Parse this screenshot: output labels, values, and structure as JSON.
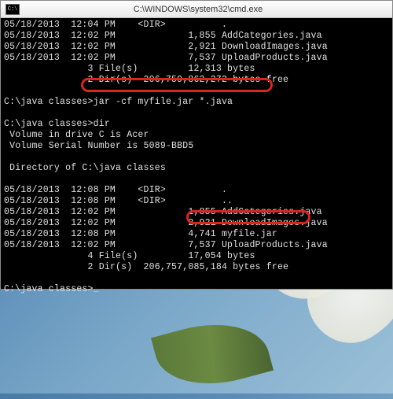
{
  "window": {
    "title": "C:\\WINDOWS\\system32\\cmd.exe",
    "icon_label": "C:\\"
  },
  "terminal": {
    "block1": {
      "l1": "05/18/2013  12:04 PM    <DIR>          .",
      "l2": "05/18/2013  12:02 PM             1,855 AddCategories.java",
      "l3": "05/18/2013  12:02 PM             2,921 DownloadImages.java",
      "l4": "05/18/2013  12:02 PM             7,537 UploadProducts.java",
      "l5": "               3 File(s)         12,313 bytes",
      "l6": "               2 Dir(s)  206,759,862,272 bytes free"
    },
    "cmd1": {
      "prompt": "C:\\java classes>",
      "command": "jar -cf myfile.jar *.java"
    },
    "cmd2": {
      "prompt": "C:\\java classes>",
      "command": "dir"
    },
    "vol": {
      "l1": " Volume in drive C is Acer",
      "l2": " Volume Serial Number is 5089-BBD5"
    },
    "dirof": " Directory of C:\\java classes",
    "block2": {
      "l1": "05/18/2013  12:08 PM    <DIR>          .",
      "l2": "05/18/2013  12:08 PM    <DIR>          ..",
      "l3": "05/18/2013  12:02 PM             1,855 AddCategories.java",
      "l4": "05/18/2013  12:02 PM             2,921 DownloadImages.java",
      "l5": "05/18/2013  12:08 PM             4,741 myfile.jar",
      "l6": "05/18/2013  12:02 PM             7,537 UploadProducts.java",
      "l7": "               4 File(s)         17,054 bytes",
      "l8": "               2 Dir(s)  206,757,085,184 bytes free"
    },
    "cmd3": {
      "prompt": "C:\\java classes>",
      "command": ""
    }
  },
  "highlights": {
    "h1": "jar -cf myfile.jar *.java",
    "h2": "4,741 myfile.jar"
  }
}
